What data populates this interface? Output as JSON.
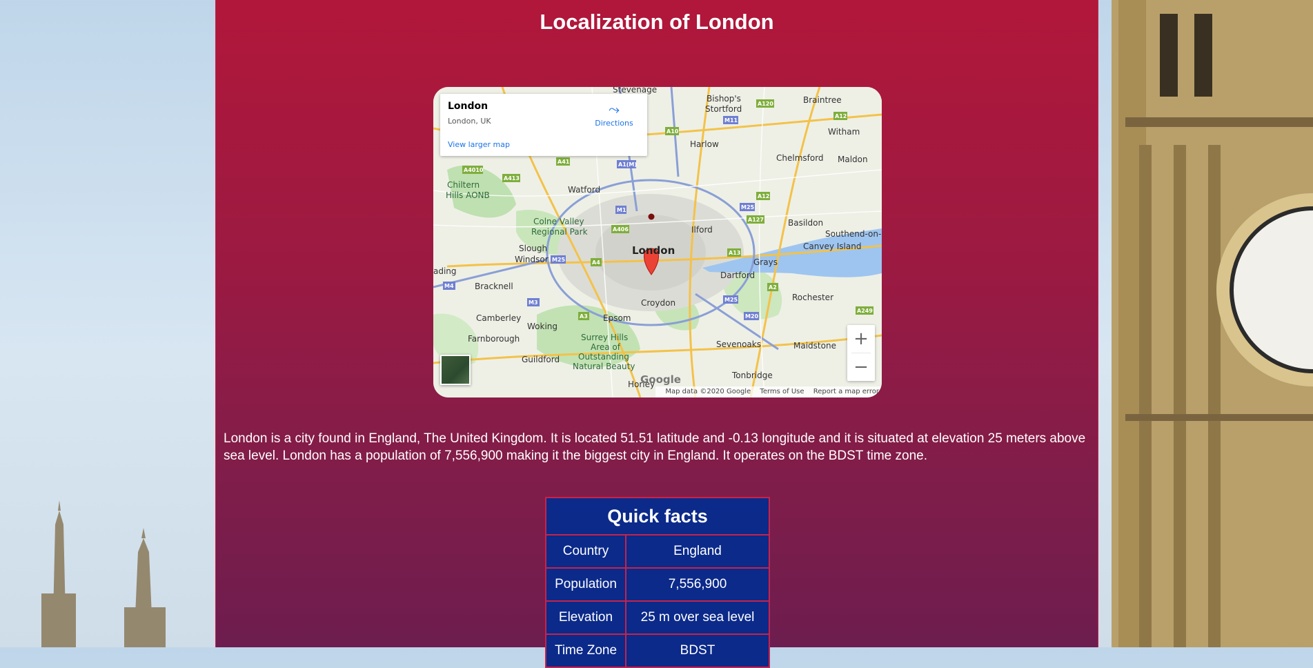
{
  "page": {
    "title": "Localization of London"
  },
  "map": {
    "card": {
      "place": "London",
      "address": "London, UK",
      "directions": "Directions",
      "larger": "View larger map"
    },
    "labels": {
      "stevenage": "Stevenage",
      "bishops": "Bishop's",
      "stortford": "Stortford",
      "braintree": "Braintree",
      "witham": "Witham",
      "harlow": "Harlow",
      "chelmsford": "Chelmsford",
      "maldon": "Maldon",
      "chiltern": "Chiltern",
      "hills_aonb": "Hills AONB",
      "watford": "Watford",
      "colne1": "Colne Valley",
      "colne2": "Regional Park",
      "basildon": "Basildon",
      "southend": "Southend-on-",
      "canvey": "Canvey Island",
      "ilford": "Ilford",
      "slough": "Slough",
      "windsor": "Windsor",
      "london": "London",
      "reading": "ading",
      "dartford": "Dartford",
      "grays": "Grays",
      "bracknell": "Bracknell",
      "rochester": "Rochester",
      "croydon": "Croydon",
      "camberley": "Camberley",
      "woking": "Woking",
      "epsom": "Epsom",
      "farnborough": "Farnborough",
      "surrey1": "Surrey Hills",
      "surrey2": "Area of",
      "surrey3": "Outstanding",
      "surrey4": "Natural Beauty",
      "sevenoaks": "Sevenoaks",
      "maidstone": "Maidstone",
      "guildford": "Guildford",
      "tonbridge": "Tonbridge",
      "horley": "Horley"
    },
    "road_badges": [
      "A120",
      "M11",
      "A12",
      "A10",
      "A41",
      "A1(M)",
      "A4010",
      "A413",
      "M1",
      "M25",
      "A12",
      "A127",
      "A406",
      "M25",
      "A4",
      "A13",
      "M4",
      "M3",
      "M25",
      "A2",
      "A3",
      "M20",
      "A249"
    ],
    "zoom_in": "+",
    "zoom_out": "−",
    "google_logo": "Google",
    "attribution": {
      "data": "Map data ©2020 Google",
      "terms": "Terms of Use",
      "report": "Report a map error"
    }
  },
  "description": "London is a city found in England, The United Kingdom. It is located 51.51 latitude and -0.13 longitude and it is situated at elevation 25 meters above sea level. London has a population of 7,556,900 making it the biggest city in England. It operates on the BDST time zone.",
  "facts": {
    "title": "Quick facts",
    "rows": [
      {
        "key": "Country",
        "value": "England"
      },
      {
        "key": "Population",
        "value": "7,556,900"
      },
      {
        "key": "Elevation",
        "value": "25 m over sea level"
      },
      {
        "key": "Time Zone",
        "value": "BDST"
      }
    ]
  },
  "colors": {
    "panel_top": "#b1173a",
    "panel_bottom": "#6d1d4f",
    "table_bg": "#0b2a8a",
    "table_border": "#c8234a",
    "link": "#1a73e8"
  }
}
